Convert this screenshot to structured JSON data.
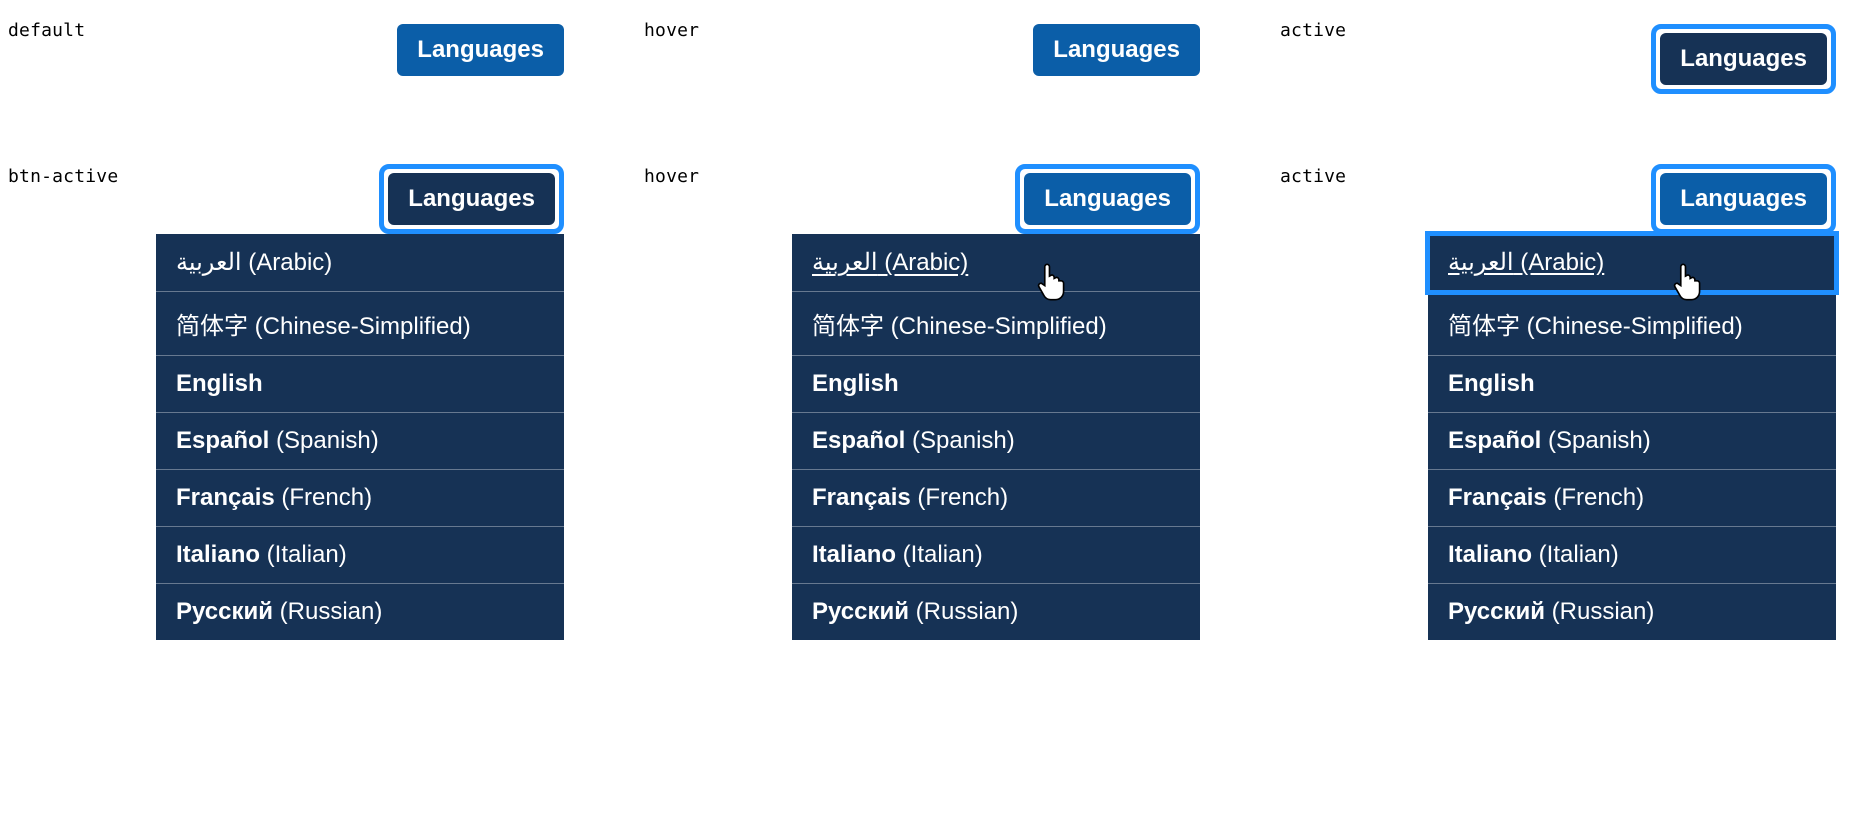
{
  "states": {
    "row1": [
      "default",
      "hover",
      "active"
    ],
    "row2": [
      "btn-active",
      "hover",
      "active"
    ]
  },
  "button_label": "Languages",
  "languages": [
    {
      "native": "العربية",
      "english": "Arabic",
      "native_bold": false
    },
    {
      "native": "简体字",
      "english": "Chinese-Simplified",
      "native_bold": false
    },
    {
      "native": "English",
      "english": "",
      "native_bold": true
    },
    {
      "native": "Español",
      "english": "Spanish",
      "native_bold": true
    },
    {
      "native": "Français",
      "english": "French",
      "native_bold": true
    },
    {
      "native": "Italiano",
      "english": "Italian",
      "native_bold": true
    },
    {
      "native": "Русский",
      "english": "Russian",
      "native_bold": true
    }
  ],
  "colors": {
    "button_default": "#0b5ea8",
    "button_dark": "#163255",
    "focus_ring": "#1f8fff",
    "dropdown_bg": "#163255",
    "divider": "rgba(255,255,255,0.35)"
  }
}
